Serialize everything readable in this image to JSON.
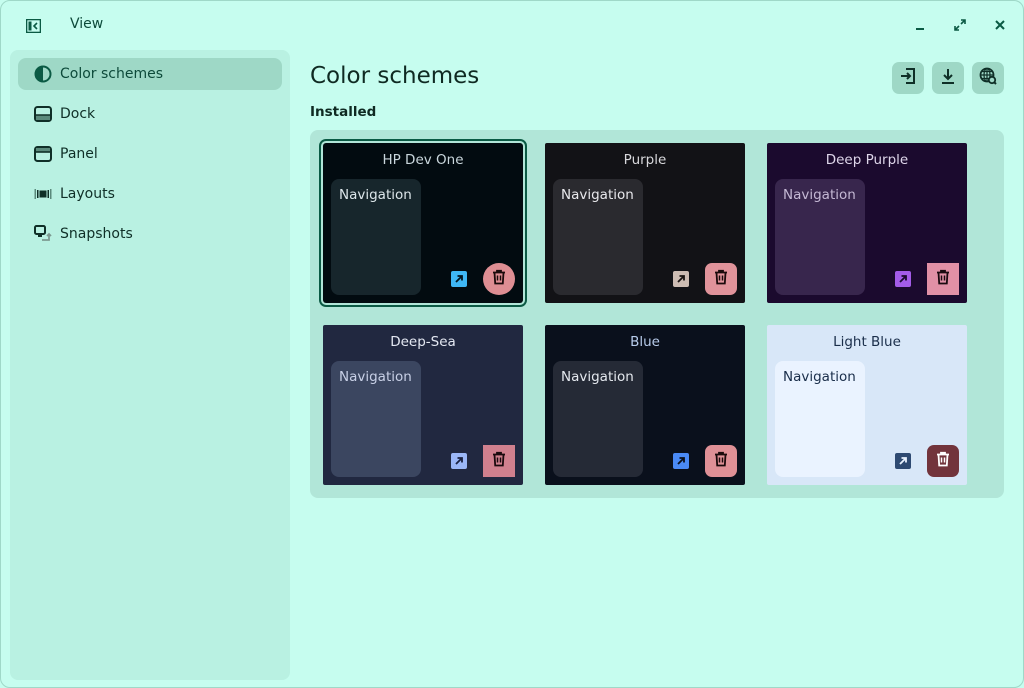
{
  "header": {
    "view_label": "View",
    "sidebar_toggle_icon": "sidebar-collapse-icon",
    "window_controls": [
      "minimize-icon",
      "maximize-icon",
      "close-icon"
    ]
  },
  "sidebar": {
    "items": [
      {
        "label": "Color schemes",
        "icon": "color-scheme-icon",
        "active": true
      },
      {
        "label": "Dock",
        "icon": "dock-icon",
        "active": false
      },
      {
        "label": "Panel",
        "icon": "panel-icon",
        "active": false
      },
      {
        "label": "Layouts",
        "icon": "layouts-icon",
        "active": false
      },
      {
        "label": "Snapshots",
        "icon": "snapshots-icon",
        "active": false
      }
    ]
  },
  "main": {
    "title": "Color schemes",
    "toolbar": [
      {
        "name": "import",
        "icon": "import-icon"
      },
      {
        "name": "download",
        "icon": "download-icon"
      },
      {
        "name": "browse-online",
        "icon": "globe-search-icon"
      }
    ],
    "section_label": "Installed",
    "schemes": [
      {
        "name": "HP Dev One",
        "nav_label": "Navigation",
        "selected": true,
        "colors": {
          "bg": "#020b10",
          "title": "#c9d6dc",
          "nav_bg": "#17262c",
          "nav_text": "#dde6ea",
          "edit": "#3fb7f5",
          "edit_fg": "#02151f",
          "delete": "#de8e93",
          "delete_fg": "#1a0a0b",
          "delete_shape": "round"
        }
      },
      {
        "name": "Purple",
        "nav_label": "Navigation",
        "selected": false,
        "colors": {
          "bg": "#121216",
          "title": "#d8d8dc",
          "nav_bg": "#2a2a2f",
          "nav_text": "#e8e8ec",
          "edit": "#cdbcb3",
          "edit_fg": "#1a1412",
          "delete": "#e0939a",
          "delete_fg": "#1a0a0b",
          "delete_shape": "rounded"
        }
      },
      {
        "name": "Deep Purple",
        "nav_label": "Navigation",
        "selected": false,
        "colors": {
          "bg": "#1b0a2e",
          "title": "#ded6ea",
          "nav_bg": "#38264d",
          "nav_text": "#c4b8d4",
          "edit": "#a35ce8",
          "edit_fg": "#1b0a2e",
          "delete": "#e190a6",
          "delete_fg": "#1a0a10",
          "delete_shape": "square"
        }
      },
      {
        "name": "Deep-Sea",
        "nav_label": "Navigation",
        "selected": false,
        "colors": {
          "bg": "#212840",
          "title": "#e4e8f2",
          "nav_bg": "#3b4660",
          "nav_text": "#c8d0e6",
          "edit": "#9bb7f7",
          "edit_fg": "#1a2140",
          "delete": "#d0808e",
          "delete_fg": "#1a0a0e",
          "delete_shape": "square"
        }
      },
      {
        "name": "Blue",
        "nav_label": "Navigation",
        "selected": false,
        "colors": {
          "bg": "#0a101c",
          "title": "#b8cceb",
          "nav_bg": "#252a36",
          "nav_text": "#e4e8ee",
          "edit": "#4a8af5",
          "edit_fg": "#0a101c",
          "delete": "#df9096",
          "delete_fg": "#1a0a0b",
          "delete_shape": "rounded"
        }
      },
      {
        "name": "Light Blue",
        "nav_label": "Navigation",
        "selected": false,
        "colors": {
          "bg": "#d8e7f8",
          "title": "#1a2e4a",
          "nav_bg": "#eaf3ff",
          "nav_text": "#1a2e4a",
          "edit": "#2e4a72",
          "edit_fg": "#eaf3ff",
          "delete": "#72343c",
          "delete_fg": "#ffffff",
          "delete_shape": "rounded"
        }
      }
    ]
  }
}
